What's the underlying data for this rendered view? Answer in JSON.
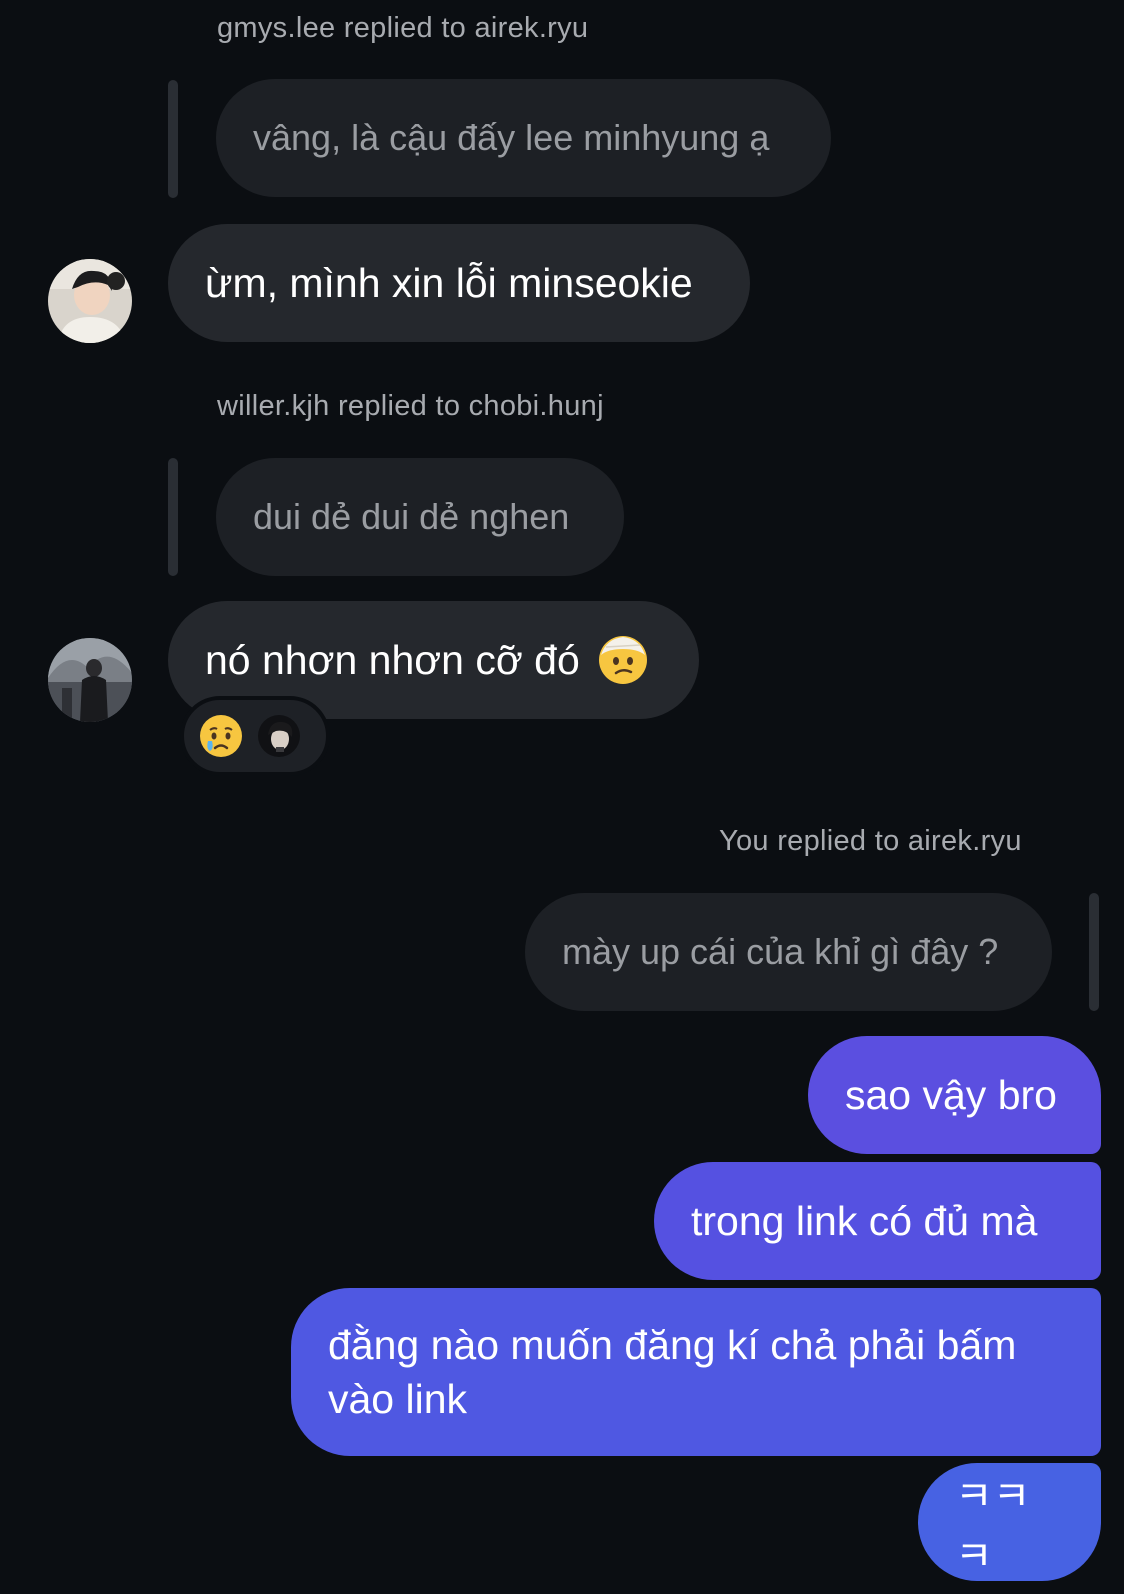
{
  "thread": {
    "reply1": {
      "label": "gmys.lee replied to airek.ryu",
      "quoted": "vâng, là cậu đấy lee minhyung ạ",
      "message": "ừm, mình xin lỗi minseokie"
    },
    "reply2": {
      "label": "willer.kjh replied to chobi.hunj",
      "quoted": "dui dẻ dui dẻ nghen",
      "message": "nó nhơn nhơn cỡ đó",
      "message_emoji": "head-bandage-emoji",
      "reactions": [
        "crying-face-emoji",
        "reactor-avatar"
      ]
    },
    "reply3": {
      "label": "You replied to airek.ryu",
      "quoted": "mày up cái của khỉ gì đây ?"
    },
    "sent": [
      "sao vậy bro",
      "trong link có đủ mà",
      "đằng nào muốn đăng kí chả phải bấm vào link",
      "ㅋㅋㅋ"
    ]
  },
  "colors": {
    "background": "#0b0e12",
    "incoming_bubble": "#25282d",
    "quoted_bubble": "#1d2025",
    "sent_gradient_top": "#5b4fe0",
    "sent_gradient_bottom": "#4762e3"
  }
}
